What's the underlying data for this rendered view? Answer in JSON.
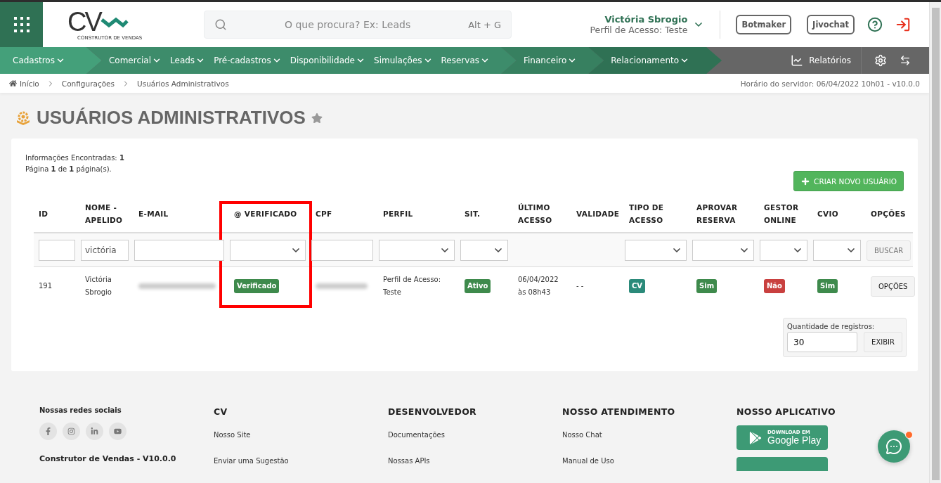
{
  "header": {
    "logo": {
      "mark": "CV",
      "tagline": "CONSTRUTOR DE VENDAS"
    },
    "search": {
      "placeholder": "O que procura? Ex: Leads",
      "shortcut": "Alt + G"
    },
    "user": {
      "name": "Victória Sbrogio",
      "profile": "Perfil de Acesso: Teste"
    },
    "buttons": [
      "Botmaker",
      "Jivochat"
    ]
  },
  "nav": {
    "sections": [
      {
        "color": "#44a07a",
        "items": [
          "Cadastros"
        ]
      },
      {
        "color": "#3d8c6b",
        "items": [
          "Comercial",
          "Leads",
          "Pré-cadastros",
          "Disponibilidade",
          "Simulações",
          "Reservas"
        ]
      },
      {
        "color": "#378060",
        "items": [
          "Financeiro"
        ]
      },
      {
        "color": "#2f7154",
        "items": [
          "Relacionamento"
        ]
      }
    ],
    "reports": "Relatórios"
  },
  "breadcrumb": {
    "items": [
      "Início",
      "Configurações",
      "Usuários Administrativos"
    ],
    "server_time": "Horário do servidor: 06/04/2022 10h01 - v10.0.0"
  },
  "page_title": "USUÁRIOS ADMINISTRATIVOS",
  "favorite": false,
  "summary": [
    "Informações Encontradas: **1**",
    "Página **1** de **1** página(s)."
  ],
  "create_button": "CRIAR NOVO USUÁRIO",
  "table": {
    "columns": [
      {
        "label": "ID",
        "highlighted": false
      },
      {
        "label": "NOME - APELIDO",
        "highlighted": false
      },
      {
        "label": "E-MAIL",
        "highlighted": false
      },
      {
        "label": "@ VERIFICADO",
        "highlighted": true
      },
      {
        "label": "CPF",
        "highlighted": false
      },
      {
        "label": "PERFIL",
        "highlighted": false
      },
      {
        "label": "SIT.",
        "highlighted": false
      },
      {
        "label": "ÚLTIMO ACESSO",
        "highlighted": false
      },
      {
        "label": "VALIDADE",
        "highlighted": false
      },
      {
        "label": "TIPO DE ACESSO",
        "highlighted": false
      },
      {
        "label": "APROVAR RESERVA",
        "highlighted": false
      },
      {
        "label": "GESTOR ONLINE",
        "highlighted": false
      },
      {
        "label": "CVIO",
        "highlighted": false
      },
      {
        "label": "OPÇÕES",
        "highlighted": false
      }
    ],
    "filters": [
      {
        "kind": "text"
      },
      {
        "kind": "text",
        "value": "victória"
      },
      {
        "kind": "text"
      },
      {
        "kind": "select"
      },
      {
        "kind": "text"
      },
      {
        "kind": "select"
      },
      {
        "kind": "select"
      },
      {
        "kind": "empty"
      },
      {
        "kind": "empty"
      },
      {
        "kind": "select"
      },
      {
        "kind": "select"
      },
      {
        "kind": "select"
      },
      {
        "kind": "select"
      },
      {
        "kind": "button",
        "value": "BUSCAR"
      }
    ],
    "rows": [
      [
        {
          "kind": "text",
          "text": "191"
        },
        {
          "kind": "text",
          "text": "Victória Sbrogio"
        },
        {
          "kind": "blurred"
        },
        {
          "kind": "badge",
          "text": "Verificado",
          "color": "#3e8a4c"
        },
        {
          "kind": "blurred"
        },
        {
          "kind": "text",
          "text": "Perfil de Acesso: Teste"
        },
        {
          "kind": "badge",
          "text": "Ativo",
          "color": "#3e8a4c"
        },
        {
          "kind": "text",
          "text": "06/04/2022 às 08h43"
        },
        {
          "kind": "text",
          "text": "- -"
        },
        {
          "kind": "badge",
          "text": "CV",
          "color": "#2b8a7a"
        },
        {
          "kind": "badge",
          "text": "Sim",
          "color": "#3e8a4c"
        },
        {
          "kind": "badge",
          "text": "Não",
          "color": "#c9403f"
        },
        {
          "kind": "badge",
          "text": "Sim",
          "color": "#3e8a4c"
        },
        {
          "kind": "button",
          "text": "OPÇÕES"
        }
      ]
    ]
  },
  "records": {
    "label": "Quantidade de registros:",
    "value": "30",
    "button": "EXIBIR"
  },
  "footer": {
    "social": {
      "title": "Nossas redes sociais",
      "version": "Construtor de Vendas - V10.0.0"
    },
    "columns": [
      {
        "title": "CV",
        "links": [
          "Nosso Site",
          "Enviar uma Sugestão"
        ]
      },
      {
        "title": "DESENVOLVEDOR",
        "links": [
          "Documentações",
          "Nossas APIs"
        ]
      },
      {
        "title": "NOSSO ATENDIMENTO",
        "links": [
          "Nosso Chat",
          "Manual de Uso"
        ]
      }
    ],
    "app": {
      "title": "NOSSO APLICATIVO",
      "badge_small": "DOWNLOAD EM",
      "badge_big": "Google Play"
    }
  },
  "chat": {
    "unread": true
  }
}
